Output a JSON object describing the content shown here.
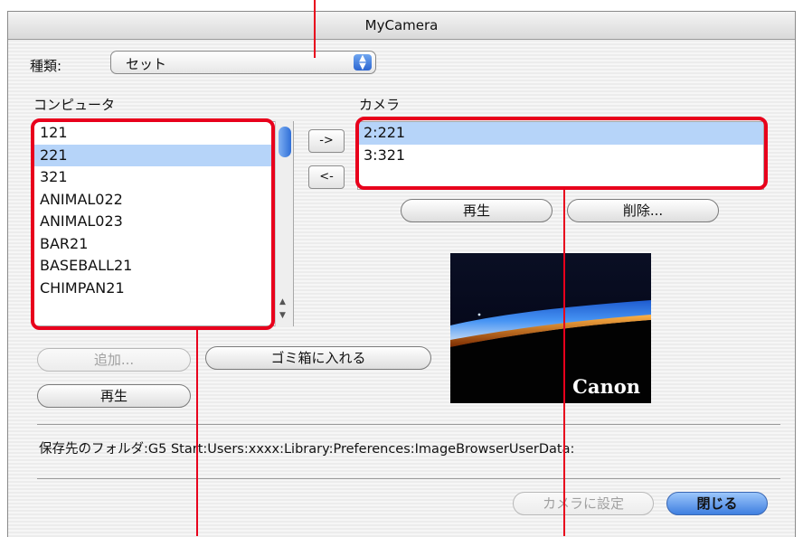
{
  "window": {
    "title": "MyCamera"
  },
  "type_select": {
    "label": "種類:",
    "value": "セット"
  },
  "computer_list": {
    "heading": "コンピュータ",
    "items": [
      "121",
      "221",
      "321",
      "ANIMAL022",
      "ANIMAL023",
      "BAR21",
      "BASEBALL21",
      "CHIMPAN21"
    ],
    "selected_index": 1
  },
  "camera_list": {
    "heading": "カメラ",
    "items": [
      "2:221",
      "3:321"
    ],
    "selected_index": 0
  },
  "transfer_buttons": {
    "to_camera": "->",
    "to_computer": "<-"
  },
  "camera_buttons": {
    "play": "再生",
    "delete": "削除..."
  },
  "computer_buttons": {
    "add": "追加...",
    "trash": "ゴミ箱に入れる",
    "play": "再生"
  },
  "preview": {
    "logo": "Canon"
  },
  "save_folder": {
    "text": "保存先のフォルダ:G5 Start:Users:xxxx:Library:Preferences:ImageBrowserUserData:"
  },
  "footer": {
    "set_to_camera": "カメラに設定",
    "close": "閉じる"
  },
  "annotation_color": "#e8001c"
}
